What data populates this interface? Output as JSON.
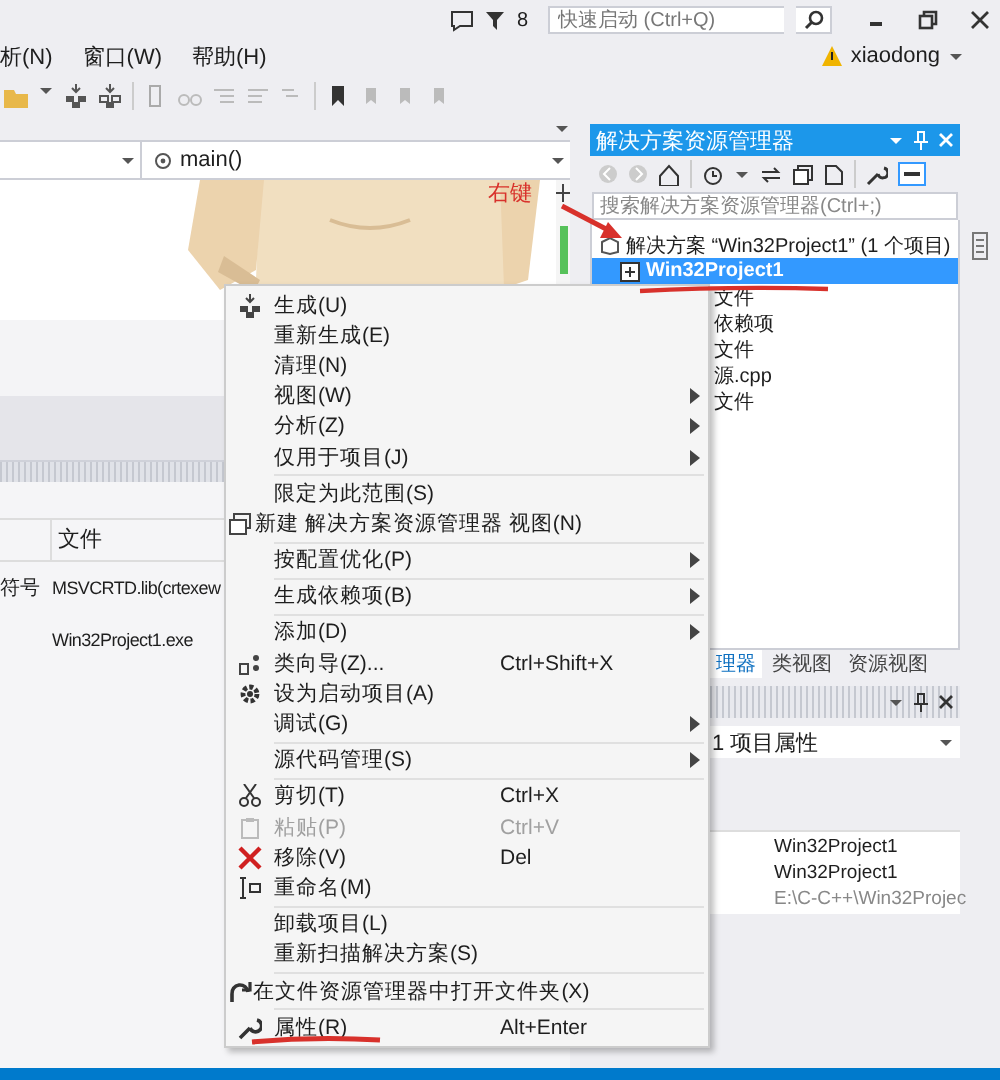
{
  "title_bar": {
    "filter_count": "8",
    "quick_launch": {
      "placeholder": "快速启动 (Ctrl+Q)"
    }
  },
  "menu_bar": {
    "items": [
      "析(N)",
      "窗口(W)",
      "帮助(H)"
    ],
    "user": "xiaodong"
  },
  "editor": {
    "member": "main()"
  },
  "output": {
    "header": "文件",
    "rows": [
      {
        "column_1": "符号",
        "file": "MSVCRTD.lib(crtexew"
      },
      {
        "column_1": "",
        "file": "Win32Project1.exe"
      }
    ]
  },
  "solution_explorer": {
    "title": "解决方案资源管理器",
    "search": {
      "placeholder": "搜索解决方案资源管理器(Ctrl+;)"
    },
    "tree": [
      {
        "label": "解决方案 “Win32Project1” (1 个项目)",
        "selected": false,
        "children": [
          {
            "label": "Win32Project1",
            "selected": true,
            "children": [
              {
                "label": "文件",
                "selected": false
              },
              {
                "label": "依赖项",
                "selected": false
              },
              {
                "label": "文件",
                "selected": false
              },
              {
                "label": "源.cpp",
                "selected": false
              },
              {
                "label": "文件",
                "selected": false
              }
            ]
          }
        ]
      }
    ],
    "tabs": [
      {
        "label": "理器",
        "selected": true
      },
      {
        "label": "类视图",
        "selected": false
      },
      {
        "label": "资源视图",
        "selected": false
      }
    ]
  },
  "properties": {
    "dropdown": "1 项目属性",
    "values": [
      {
        "text": "Win32Project1",
        "disabled": false
      },
      {
        "text": "Win32Project1",
        "disabled": false
      },
      {
        "text": "E:\\C-C++\\Win32Projec",
        "disabled": true
      }
    ]
  },
  "context_menu": {
    "groups": [
      [
        {
          "label": "生成(U)",
          "submenu": false,
          "disabled": false
        },
        {
          "label": "重新生成(E)",
          "submenu": false,
          "disabled": false
        },
        {
          "label": "清理(N)",
          "submenu": false,
          "disabled": false
        },
        {
          "label": "视图(W)",
          "submenu": true,
          "disabled": false
        },
        {
          "label": "分析(Z)",
          "submenu": true,
          "disabled": false
        },
        {
          "label": "仅用于项目(J)",
          "submenu": true,
          "disabled": false
        }
      ],
      [
        {
          "label": "限定为此范围(S)",
          "submenu": false,
          "disabled": false
        },
        {
          "label": "新建 解决方案资源管理器 视图(N)",
          "submenu": false,
          "disabled": false
        }
      ],
      [
        {
          "label": "按配置优化(P)",
          "submenu": true,
          "disabled": false
        }
      ],
      [
        {
          "label": "生成依赖项(B)",
          "submenu": true,
          "disabled": false
        }
      ],
      [
        {
          "label": "添加(D)",
          "submenu": true,
          "disabled": false
        },
        {
          "label": "类向导(Z)...",
          "shortcut": "Ctrl+Shift+X",
          "submenu": false,
          "disabled": false
        },
        {
          "label": "设为启动项目(A)",
          "submenu": false,
          "disabled": false
        },
        {
          "label": "调试(G)",
          "submenu": true,
          "disabled": false
        }
      ],
      [
        {
          "label": "源代码管理(S)",
          "submenu": true,
          "disabled": false
        }
      ],
      [
        {
          "label": "剪切(T)",
          "shortcut": "Ctrl+X",
          "submenu": false,
          "disabled": false
        },
        {
          "label": "粘贴(P)",
          "shortcut": "Ctrl+V",
          "submenu": false,
          "disabled": true
        },
        {
          "label": "移除(V)",
          "shortcut": "Del",
          "submenu": false,
          "disabled": false
        },
        {
          "label": "重命名(M)",
          "submenu": false,
          "disabled": false
        }
      ],
      [
        {
          "label": "卸载项目(L)",
          "submenu": false,
          "disabled": false
        },
        {
          "label": "重新扫描解决方案(S)",
          "submenu": false,
          "disabled": false
        }
      ],
      [
        {
          "label": "在文件资源管理器中打开文件夹(X)",
          "submenu": false,
          "disabled": false
        }
      ],
      [
        {
          "label": "属性(R)",
          "shortcut": "Alt+Enter",
          "submenu": false,
          "disabled": false
        }
      ]
    ]
  },
  "annotation": {
    "label": "右键"
  }
}
